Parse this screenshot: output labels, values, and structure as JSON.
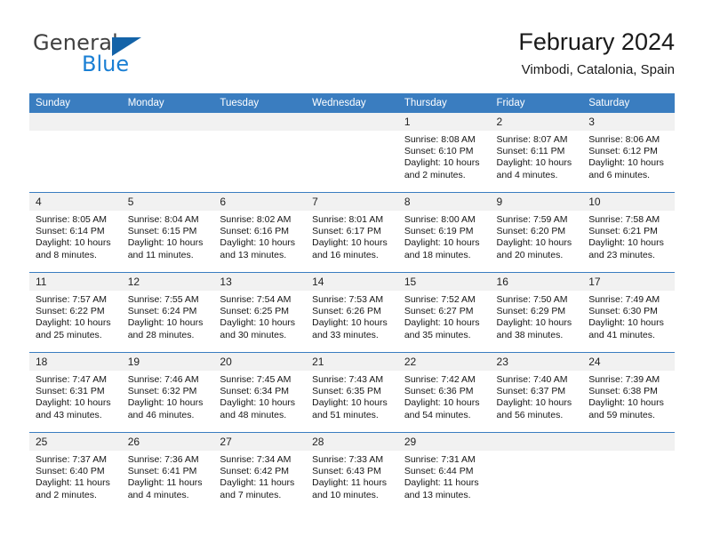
{
  "brand": {
    "name_top": "General",
    "name_bottom": "Blue",
    "triangle_color": "#1463a8",
    "blue_color": "#1a7fd4"
  },
  "header": {
    "title": "February 2024",
    "location": "Vimbodi, Catalonia, Spain"
  },
  "theme": {
    "header_bg": "#3a7dc0",
    "daynum_bg": "#f1f1f1",
    "grid_line": "#3a7dc0",
    "text": "#161616"
  },
  "weekday_headers": [
    "Sunday",
    "Monday",
    "Tuesday",
    "Wednesday",
    "Thursday",
    "Friday",
    "Saturday"
  ],
  "weeks": [
    [
      {
        "day": "",
        "empty": true
      },
      {
        "day": "",
        "empty": true
      },
      {
        "day": "",
        "empty": true
      },
      {
        "day": "",
        "empty": true
      },
      {
        "day": "1",
        "sunrise": "Sunrise: 8:08 AM",
        "sunset": "Sunset: 6:10 PM",
        "daylight": "Daylight: 10 hours and 2 minutes."
      },
      {
        "day": "2",
        "sunrise": "Sunrise: 8:07 AM",
        "sunset": "Sunset: 6:11 PM",
        "daylight": "Daylight: 10 hours and 4 minutes."
      },
      {
        "day": "3",
        "sunrise": "Sunrise: 8:06 AM",
        "sunset": "Sunset: 6:12 PM",
        "daylight": "Daylight: 10 hours and 6 minutes."
      }
    ],
    [
      {
        "day": "4",
        "sunrise": "Sunrise: 8:05 AM",
        "sunset": "Sunset: 6:14 PM",
        "daylight": "Daylight: 10 hours and 8 minutes."
      },
      {
        "day": "5",
        "sunrise": "Sunrise: 8:04 AM",
        "sunset": "Sunset: 6:15 PM",
        "daylight": "Daylight: 10 hours and 11 minutes."
      },
      {
        "day": "6",
        "sunrise": "Sunrise: 8:02 AM",
        "sunset": "Sunset: 6:16 PM",
        "daylight": "Daylight: 10 hours and 13 minutes."
      },
      {
        "day": "7",
        "sunrise": "Sunrise: 8:01 AM",
        "sunset": "Sunset: 6:17 PM",
        "daylight": "Daylight: 10 hours and 16 minutes."
      },
      {
        "day": "8",
        "sunrise": "Sunrise: 8:00 AM",
        "sunset": "Sunset: 6:19 PM",
        "daylight": "Daylight: 10 hours and 18 minutes."
      },
      {
        "day": "9",
        "sunrise": "Sunrise: 7:59 AM",
        "sunset": "Sunset: 6:20 PM",
        "daylight": "Daylight: 10 hours and 20 minutes."
      },
      {
        "day": "10",
        "sunrise": "Sunrise: 7:58 AM",
        "sunset": "Sunset: 6:21 PM",
        "daylight": "Daylight: 10 hours and 23 minutes."
      }
    ],
    [
      {
        "day": "11",
        "sunrise": "Sunrise: 7:57 AM",
        "sunset": "Sunset: 6:22 PM",
        "daylight": "Daylight: 10 hours and 25 minutes."
      },
      {
        "day": "12",
        "sunrise": "Sunrise: 7:55 AM",
        "sunset": "Sunset: 6:24 PM",
        "daylight": "Daylight: 10 hours and 28 minutes."
      },
      {
        "day": "13",
        "sunrise": "Sunrise: 7:54 AM",
        "sunset": "Sunset: 6:25 PM",
        "daylight": "Daylight: 10 hours and 30 minutes."
      },
      {
        "day": "14",
        "sunrise": "Sunrise: 7:53 AM",
        "sunset": "Sunset: 6:26 PM",
        "daylight": "Daylight: 10 hours and 33 minutes."
      },
      {
        "day": "15",
        "sunrise": "Sunrise: 7:52 AM",
        "sunset": "Sunset: 6:27 PM",
        "daylight": "Daylight: 10 hours and 35 minutes."
      },
      {
        "day": "16",
        "sunrise": "Sunrise: 7:50 AM",
        "sunset": "Sunset: 6:29 PM",
        "daylight": "Daylight: 10 hours and 38 minutes."
      },
      {
        "day": "17",
        "sunrise": "Sunrise: 7:49 AM",
        "sunset": "Sunset: 6:30 PM",
        "daylight": "Daylight: 10 hours and 41 minutes."
      }
    ],
    [
      {
        "day": "18",
        "sunrise": "Sunrise: 7:47 AM",
        "sunset": "Sunset: 6:31 PM",
        "daylight": "Daylight: 10 hours and 43 minutes."
      },
      {
        "day": "19",
        "sunrise": "Sunrise: 7:46 AM",
        "sunset": "Sunset: 6:32 PM",
        "daylight": "Daylight: 10 hours and 46 minutes."
      },
      {
        "day": "20",
        "sunrise": "Sunrise: 7:45 AM",
        "sunset": "Sunset: 6:34 PM",
        "daylight": "Daylight: 10 hours and 48 minutes."
      },
      {
        "day": "21",
        "sunrise": "Sunrise: 7:43 AM",
        "sunset": "Sunset: 6:35 PM",
        "daylight": "Daylight: 10 hours and 51 minutes."
      },
      {
        "day": "22",
        "sunrise": "Sunrise: 7:42 AM",
        "sunset": "Sunset: 6:36 PM",
        "daylight": "Daylight: 10 hours and 54 minutes."
      },
      {
        "day": "23",
        "sunrise": "Sunrise: 7:40 AM",
        "sunset": "Sunset: 6:37 PM",
        "daylight": "Daylight: 10 hours and 56 minutes."
      },
      {
        "day": "24",
        "sunrise": "Sunrise: 7:39 AM",
        "sunset": "Sunset: 6:38 PM",
        "daylight": "Daylight: 10 hours and 59 minutes."
      }
    ],
    [
      {
        "day": "25",
        "sunrise": "Sunrise: 7:37 AM",
        "sunset": "Sunset: 6:40 PM",
        "daylight": "Daylight: 11 hours and 2 minutes."
      },
      {
        "day": "26",
        "sunrise": "Sunrise: 7:36 AM",
        "sunset": "Sunset: 6:41 PM",
        "daylight": "Daylight: 11 hours and 4 minutes."
      },
      {
        "day": "27",
        "sunrise": "Sunrise: 7:34 AM",
        "sunset": "Sunset: 6:42 PM",
        "daylight": "Daylight: 11 hours and 7 minutes."
      },
      {
        "day": "28",
        "sunrise": "Sunrise: 7:33 AM",
        "sunset": "Sunset: 6:43 PM",
        "daylight": "Daylight: 11 hours and 10 minutes."
      },
      {
        "day": "29",
        "sunrise": "Sunrise: 7:31 AM",
        "sunset": "Sunset: 6:44 PM",
        "daylight": "Daylight: 11 hours and 13 minutes."
      },
      {
        "day": "",
        "empty": true
      },
      {
        "day": "",
        "empty": true
      }
    ]
  ]
}
